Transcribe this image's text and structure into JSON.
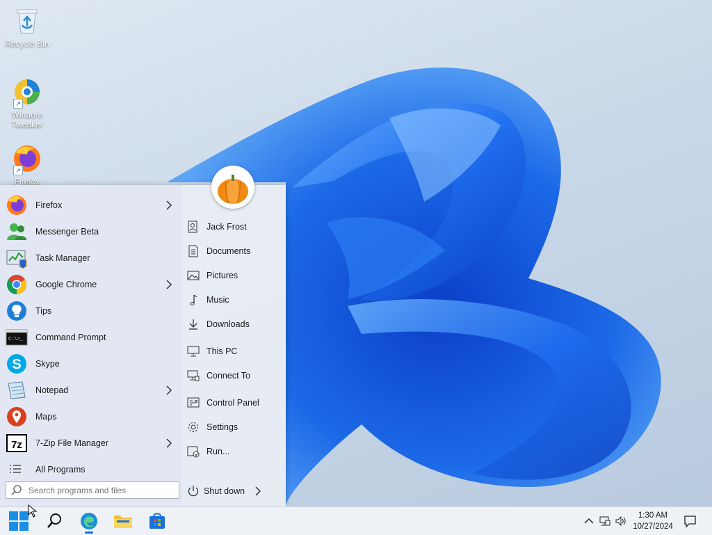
{
  "desktop": {
    "icons": [
      {
        "label": "Recycle Bin"
      },
      {
        "label": "Winaero\nTweaker"
      },
      {
        "label": "Firefox"
      }
    ]
  },
  "start_menu": {
    "programs": [
      {
        "label": "Firefox",
        "icon": "firefox-icon",
        "has_submenu": true
      },
      {
        "label": "Messenger Beta",
        "icon": "messenger-icon",
        "has_submenu": false
      },
      {
        "label": "Task Manager",
        "icon": "task-manager-icon",
        "has_submenu": false
      },
      {
        "label": "Google Chrome",
        "icon": "chrome-icon",
        "has_submenu": true
      },
      {
        "label": "Tips",
        "icon": "tips-icon",
        "has_submenu": false
      },
      {
        "label": "Command Prompt",
        "icon": "command-prompt-icon",
        "has_submenu": false
      },
      {
        "label": "Skype",
        "icon": "skype-icon",
        "has_submenu": false
      },
      {
        "label": "Notepad",
        "icon": "notepad-icon",
        "has_submenu": true
      },
      {
        "label": "Maps",
        "icon": "maps-icon",
        "has_submenu": false
      },
      {
        "label": "7-Zip File Manager",
        "icon": "seven-zip-icon",
        "has_submenu": true
      }
    ],
    "all_programs_label": "All Programs",
    "search_placeholder": "Search programs and files",
    "places": [
      {
        "label": "Jack Frost",
        "icon": "user-folder-icon"
      },
      {
        "label": "Documents",
        "icon": "documents-icon"
      },
      {
        "label": "Pictures",
        "icon": "pictures-icon"
      },
      {
        "label": "Music",
        "icon": "music-icon"
      },
      {
        "label": "Downloads",
        "icon": "downloads-icon"
      },
      {
        "label": "This PC",
        "icon": "this-pc-icon"
      },
      {
        "label": "Connect To",
        "icon": "connect-to-icon"
      },
      {
        "label": "Control Panel",
        "icon": "control-panel-icon"
      },
      {
        "label": "Settings",
        "icon": "settings-gear-icon"
      },
      {
        "label": "Run...",
        "icon": "run-icon"
      }
    ],
    "shutdown_label": "Shut down"
  },
  "taskbar": {
    "time": "1:30 AM",
    "date": "10/27/2024"
  },
  "colors": {
    "wallpaper_blue": "#1a5fe0",
    "start_menu_bg": "#e8ecf4",
    "taskbar_bg": "#eef1f6"
  }
}
